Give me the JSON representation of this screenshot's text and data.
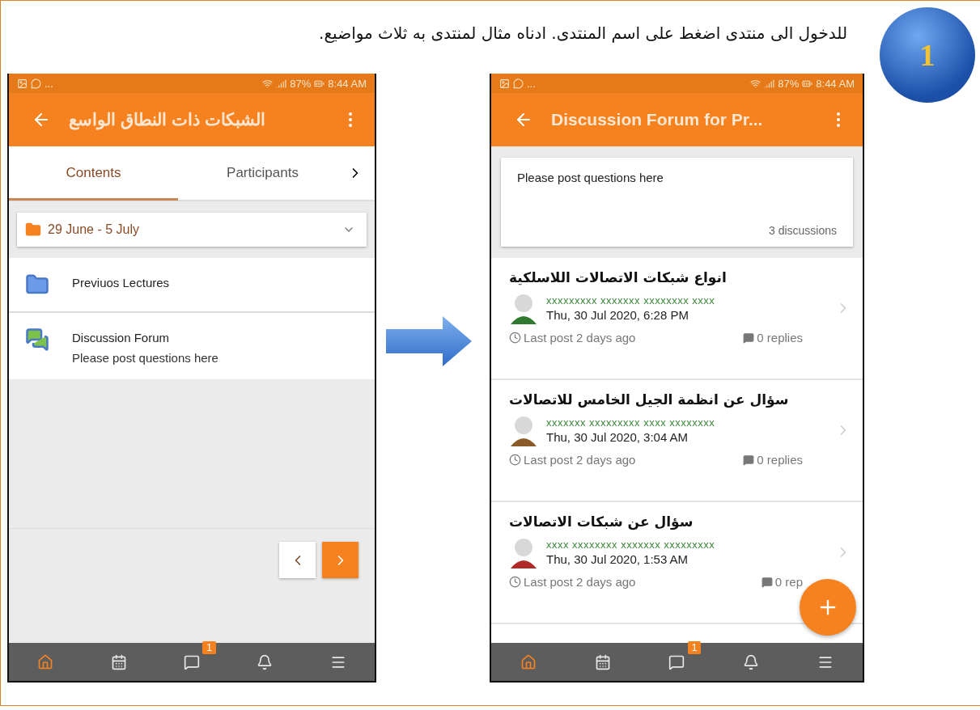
{
  "instruction": "للدخول الى منتدى اضغط على اسم المنتدى. ادناه مثال لمنتدى به ثلاث مواضيع.",
  "step_number": "1",
  "course_screen": {
    "status": {
      "more": "...",
      "battery": "87%",
      "time": "8:44 AM"
    },
    "title": "الشبكات ذات النطاق الواسع",
    "tabs": [
      {
        "label": "Contents",
        "selected": true
      },
      {
        "label": "Participants",
        "selected": false
      }
    ],
    "section": "29 June - 5 July",
    "modules": [
      {
        "kind": "folder",
        "name": "Previuos Lectures"
      },
      {
        "kind": "forum",
        "name": "Discussion Forum",
        "description": "Please post questions here"
      }
    ],
    "nav": [
      {
        "kind": "home",
        "selected": true
      },
      {
        "kind": "calendar",
        "selected": false
      },
      {
        "kind": "messages",
        "selected": false,
        "badge": "1"
      },
      {
        "kind": "notifications",
        "selected": false
      },
      {
        "kind": "menu",
        "selected": false
      }
    ]
  },
  "forum_screen": {
    "status": {
      "more": "...",
      "battery": "87%",
      "time": "8:44 AM"
    },
    "title": "Discussion Forum for Pr...",
    "intro": "Please post questions here",
    "count": "3 discussions",
    "discussions": [
      {
        "title": "انواع شبكات الاتصالات اللاسلكية",
        "author": "xxxxxxxxx xxxxxxx xxxxxxxx xxxx",
        "date": "Thu, 30 Jul 2020, 6:28 PM",
        "last_post": "Last post 2 days ago",
        "replies": "0 replies"
      },
      {
        "title": "سؤال عن انظمة الجيل الخامس للاتصالات",
        "author": "xxxxxxx xxxxxxxxx xxxx xxxxxxxx",
        "date": "Thu, 30 Jul 2020, 3:04 AM",
        "last_post": "Last post 2 days ago",
        "replies": "0 replies"
      },
      {
        "title": "سؤال عن شبكات الاتصالات",
        "author": "xxxx xxxxxxxx xxxxxxx xxxxxxxxx",
        "date": "Thu, 30 Jul 2020, 1:53 AM",
        "last_post": "Last post 2 days ago",
        "replies": "0 rep"
      }
    ],
    "nav": [
      {
        "kind": "home",
        "selected": true
      },
      {
        "kind": "calendar",
        "selected": false
      },
      {
        "kind": "messages",
        "selected": false,
        "badge": "1"
      },
      {
        "kind": "notifications",
        "selected": false
      },
      {
        "kind": "menu",
        "selected": false
      }
    ]
  }
}
